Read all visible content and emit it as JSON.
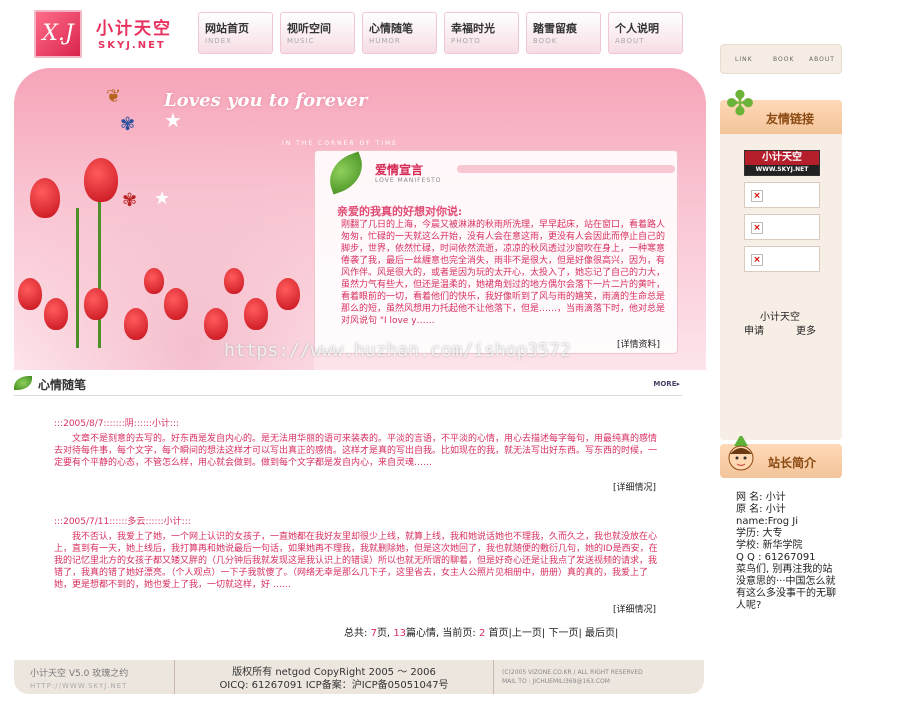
{
  "header": {
    "logo_mark": "X.J",
    "logo_title": "小计天空",
    "logo_sub": "SKYJ.NET",
    "nav": [
      {
        "label": "网站首页",
        "sub": "INDEX"
      },
      {
        "label": "视听空间",
        "sub": "MUSIC"
      },
      {
        "label": "心情随笔",
        "sub": "HUMOR"
      },
      {
        "label": "幸福时光",
        "sub": "PHOTO"
      },
      {
        "label": "踏雪留痕",
        "sub": "BOOK"
      },
      {
        "label": "个人说明",
        "sub": "ABOUT"
      }
    ]
  },
  "banner": {
    "slogan": "Loves you to forever",
    "slogan_sub": "IN THE CORNER OF TIME",
    "love_title": "爱情宣言",
    "love_sub": "LOVE MANIFESTO",
    "love_heading": "亲爱的我真的好想对你说:",
    "love_text": "刚翻了几日的上海，今晨又被淋淋的秋雨所洗理，早早起床，站在窗口，看着路人匆匆，忙碌的一天就这么开始，没有人会在意这雨，更没有人会因此而停止自己的脚步，世界，依然忙碌，时间依然流逝，凉凉的秋风透过沙窗吹在身上，一种寒意倦袭了我，最后一丝緾意也完全消失，雨非不是很大，但是好像很高兴，因为，有风作伴。风是很大的，或者是因为玩的太开心，太投入了，她忘记了自己的力大，虽然力气有些大，但还是温柔的，她裙角划过的地方偶尔会落下一片二片的黄叶，看着眼前的一切，看着他们的快乐，我好像听到了风与雨的嬉笑，雨滴的生命总是那么的短，虽然风想用力托起他不让他落下，但是……，当雨滴落下时，他对总是对风说句 \"I love y……",
    "love_more": "[详情资料]"
  },
  "watermark": "https://www.huzhan.com/ishop3572",
  "mood": {
    "title": "心情随笔",
    "more": "MORE▸",
    "posts": [
      {
        "meta": ":::2005/8/7:::::::阴::::::小计:::",
        "body": "文章不是刻意的去写的。好东西是发自内心的。是无法用华丽的语可来装表的。平淡的言语，不平淡的心情，用心去描述每字每句，用最纯真的感情去对待每件事，每个文字，每个瞬间的想法这样才可以写出真正的感情。这样才是真的写出自我。比如现在的我，就无法写出好东西。写东西的时候，一定要有个平静的心态，不管怎么样，用心就会做到。做到每个文字都是发自内心，来自灵魂……",
        "more": "[详细情况]"
      },
      {
        "meta": ":::2005/7/11::::::多云::::::小计:::",
        "body": "我不否认，我爱上了她，一个网上认识的女孩子，一直她都在我好友里却很少上线，就算上线，我和她说话她也不理我，久而久之，我也就没放在心上，直到有一天，她上线后，我打算再和她说最后一句话，如果她再不理我，我就删除她，但是这次她回了，我也就随便的敷衍几句，她的ID是西安，在我的记忆里北方的女孩子都又矮又胖的（几分钟后我就发现这是我认识上的错误）所以也就无所谓的聊着，但是好奇心还是让我点了发送视频的请求，我错了，我真的错了她好漂亮。（个人观点）一下子我就傻了。（网络无幸是那么几下子，这里省去，女主人公照片见相册中，册册）真的真的，我爱上了她，更是想都不到的，她也爱上了我，一切就这样，好 ……",
        "more": "[详细情况]"
      }
    ],
    "pager": {
      "total_label": "总共:",
      "total_pages": "7",
      "pages_unit": "页,",
      "per_page": "13",
      "per_page_unit": "篇心情,",
      "current_label": "当前页:",
      "current": "2",
      "links": "首页|上一页| 下一页| 最后页|"
    }
  },
  "footer": {
    "left_title": "小计天空 V5.0 玫瑰之约",
    "left_url": "HTTP://WWW.SKYJ.NET",
    "copyright": "版权所有 netgod CopyRight 2005 ～ 2006",
    "contact": "OICQ: 61267091 ICP备案：沪ICP备05051047号",
    "right_line1": "(C)2005 VIZONE.CO.KR / ALL RIGHT RESERVED",
    "right_line2": "MAIL TO : JICHUEMILI369@163.COM"
  },
  "sidebar": {
    "top_links": [
      "LINK",
      "BOOK",
      "ABOUT"
    ],
    "friends_title": "友情链接",
    "friend_logo_main": "小计天空",
    "friend_logo_sub": "WWW.SKYJ.NET",
    "site_name": "小计天空",
    "apply": "申请",
    "more": "更多",
    "owner_title": "站长简介",
    "owner_info": {
      "name": "网  名: 小计",
      "real": "原  名: 小计",
      "ename": "name:Frog Ji",
      "edu": "学历: 大专",
      "school": "学校: 新华学院",
      "qq": "Q Q : 61267091",
      "msg": "菜鸟们, 别再注我的站 没意思的···中国怎么就 有这么多没事干的无聊 人呢?"
    }
  }
}
